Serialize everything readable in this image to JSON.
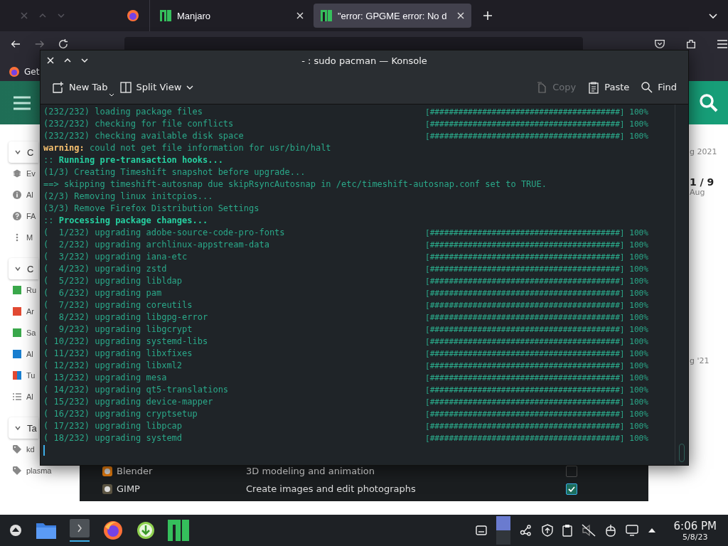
{
  "browser": {
    "tabs": [
      {
        "title": "Manjaro",
        "selected": false
      },
      {
        "title": "\"error: GPGME error: No d",
        "selected": true
      }
    ],
    "bookmark": "Get"
  },
  "forum": {
    "sections": [
      {
        "title": "C",
        "expanded": true,
        "items": [
          {
            "kind": "layers",
            "label": "Ev"
          },
          {
            "kind": "info",
            "label": "Al"
          },
          {
            "kind": "help",
            "label": "FA"
          },
          {
            "kind": "more",
            "label": "M"
          }
        ]
      },
      {
        "title": "C",
        "expanded": true,
        "items": [
          {
            "kind": "category",
            "label": "Ru",
            "color": "#3aa84b"
          },
          {
            "kind": "category",
            "label": "Ar",
            "color": "#e24a33"
          },
          {
            "kind": "category",
            "label": "Sa",
            "color": "#3aa84b"
          },
          {
            "kind": "category",
            "label": "Al",
            "color": "#1a7fd0"
          },
          {
            "kind": "split",
            "label": "Tu",
            "segments": [
              {
                "color": "#e24a33"
              },
              {
                "color": "#1a7fd0"
              }
            ]
          },
          {
            "kind": "list",
            "label": "Al"
          }
        ]
      },
      {
        "title": "Ta",
        "expanded": true,
        "items": [
          {
            "kind": "tag",
            "label": "kd"
          },
          {
            "kind": "tag",
            "label": "plasma"
          }
        ]
      }
    ],
    "side": [
      {
        "kind": "date",
        "text": "g 2021"
      },
      {
        "kind": "counter",
        "text": "1 / 9"
      },
      {
        "kind": "date",
        "text": "Aug"
      },
      {
        "kind": "date",
        "text": "g '21"
      }
    ]
  },
  "konsole": {
    "title": "- : sudo pacman — Konsole",
    "toolbar": [
      {
        "kind": "newtab",
        "label": "New Tab",
        "disabled": false
      },
      {
        "kind": "split",
        "label": "Split View",
        "disabled": false
      },
      {
        "kind": "copy",
        "label": "Copy",
        "disabled": true
      },
      {
        "kind": "paste",
        "label": "Paste",
        "disabled": false
      },
      {
        "kind": "find",
        "label": "Find",
        "disabled": false
      }
    ],
    "lines": [
      {
        "kind": "plain",
        "text": "(232/232) loading package files",
        "progress": "[########################################] 100%"
      },
      {
        "kind": "plain",
        "text": "(232/232) checking for file conflicts",
        "progress": "[########################################] 100%"
      },
      {
        "kind": "plain",
        "text": "(232/232) checking available disk space",
        "progress": "[########################################] 100%"
      },
      {
        "kind": "warning",
        "prefix": "warning:",
        "text": " could not get file information for usr/bin/halt"
      },
      {
        "kind": "heading",
        "prefix": "::",
        "text": " Running pre-transaction hooks..."
      },
      {
        "kind": "plain",
        "text": "(1/3) Creating Timeshift snapshot before upgrade..."
      },
      {
        "kind": "plain",
        "text": "==> skipping timeshift-autosnap due skipRsyncAutosnap in /etc/timeshift-autosnap.conf set to TRUE."
      },
      {
        "kind": "plain",
        "text": "(2/3) Removing linux initcpios..."
      },
      {
        "kind": "plain",
        "text": "(3/3) Remove Firefox Distribution Settings"
      },
      {
        "kind": "heading",
        "prefix": "::",
        "text": " Processing package changes..."
      },
      {
        "kind": "plain",
        "text": "(  1/232) upgrading adobe-source-code-pro-fonts",
        "progress": "[########################################] 100%"
      },
      {
        "kind": "plain",
        "text": "(  2/232) upgrading archlinux-appstream-data",
        "progress": "[########################################] 100%"
      },
      {
        "kind": "plain",
        "text": "(  3/232) upgrading iana-etc",
        "progress": "[########################################] 100%"
      },
      {
        "kind": "plain",
        "text": "(  4/232) upgrading zstd",
        "progress": "[########################################] 100%"
      },
      {
        "kind": "plain",
        "text": "(  5/232) upgrading libldap",
        "progress": "[########################################] 100%"
      },
      {
        "kind": "plain",
        "text": "(  6/232) upgrading pam",
        "progress": "[########################################] 100%"
      },
      {
        "kind": "plain",
        "text": "(  7/232) upgrading coreutils",
        "progress": "[########################################] 100%"
      },
      {
        "kind": "plain",
        "text": "(  8/232) upgrading libgpg-error",
        "progress": "[########################################] 100%"
      },
      {
        "kind": "plain",
        "text": "(  9/232) upgrading libgcrypt",
        "progress": "[########################################] 100%"
      },
      {
        "kind": "plain",
        "text": "( 10/232) upgrading systemd-libs",
        "progress": "[########################################] 100%"
      },
      {
        "kind": "plain",
        "text": "( 11/232) upgrading libxfixes",
        "progress": "[########################################] 100%"
      },
      {
        "kind": "plain",
        "text": "( 12/232) upgrading libxml2",
        "progress": "[########################################] 100%"
      },
      {
        "kind": "plain",
        "text": "( 13/232) upgrading mesa",
        "progress": "[########################################] 100%"
      },
      {
        "kind": "plain",
        "text": "( 14/232) upgrading qt5-translations",
        "progress": "[########################################] 100%"
      },
      {
        "kind": "plain",
        "text": "( 15/232) upgrading device-mapper",
        "progress": "[########################################] 100%"
      },
      {
        "kind": "plain",
        "text": "( 16/232) upgrading cryptsetup",
        "progress": "[########################################] 100%"
      },
      {
        "kind": "plain",
        "text": "( 17/232) upgrading libpcap",
        "progress": "[########################################] 100%"
      },
      {
        "kind": "plain",
        "text": "( 18/232) upgrading systemd",
        "progress": "[########################################] 100%"
      }
    ]
  },
  "software": [
    {
      "name": "Blender",
      "description": "3D modeling and animation",
      "checked": false
    },
    {
      "name": "GIMP",
      "description": "Create images and edit photographs",
      "checked": true
    }
  ],
  "taskbar": {
    "time": "6:06 PM",
    "date": "5/8/23"
  }
}
